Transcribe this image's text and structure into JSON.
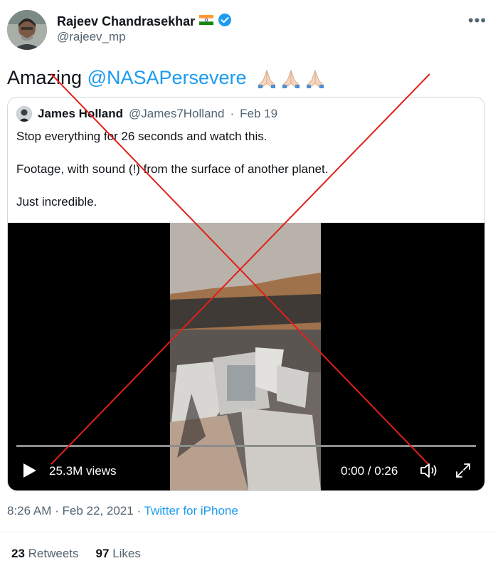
{
  "author": {
    "name": "Rajeev Chandrasekhar",
    "handle": "@rajeev_mp",
    "flag_icon": "india-flag-icon",
    "verified_icon": "verified-badge-icon"
  },
  "more_label": "•••",
  "tweet": {
    "text": "Amazing",
    "mention": "@NASAPersevere",
    "emoji_count": 3,
    "emoji_icon": "folded-hands-icon"
  },
  "quoted": {
    "name": "James Holland",
    "handle": "@James7Holland",
    "separator": "·",
    "date": "Feb 19",
    "lines": [
      "Stop everything for 26 seconds and watch this.",
      "Footage, with sound (!) from the surface of another planet.",
      "Just incredible."
    ],
    "video": {
      "views": "25.3M views",
      "time": "0:00 / 0:26",
      "progress": 0,
      "icons": [
        "play-icon",
        "volume-icon",
        "fullscreen-icon"
      ]
    }
  },
  "footer": {
    "time": "8:26 AM",
    "date": "Feb 22, 2021",
    "source": "Twitter for iPhone",
    "sep": "·"
  },
  "stats": {
    "retweets_count": "23",
    "retweets_label": "Retweets",
    "likes_count": "97",
    "likes_label": "Likes"
  },
  "colors": {
    "link": "#1d9bf0",
    "muted": "#536471",
    "cross": "#e0201a"
  }
}
